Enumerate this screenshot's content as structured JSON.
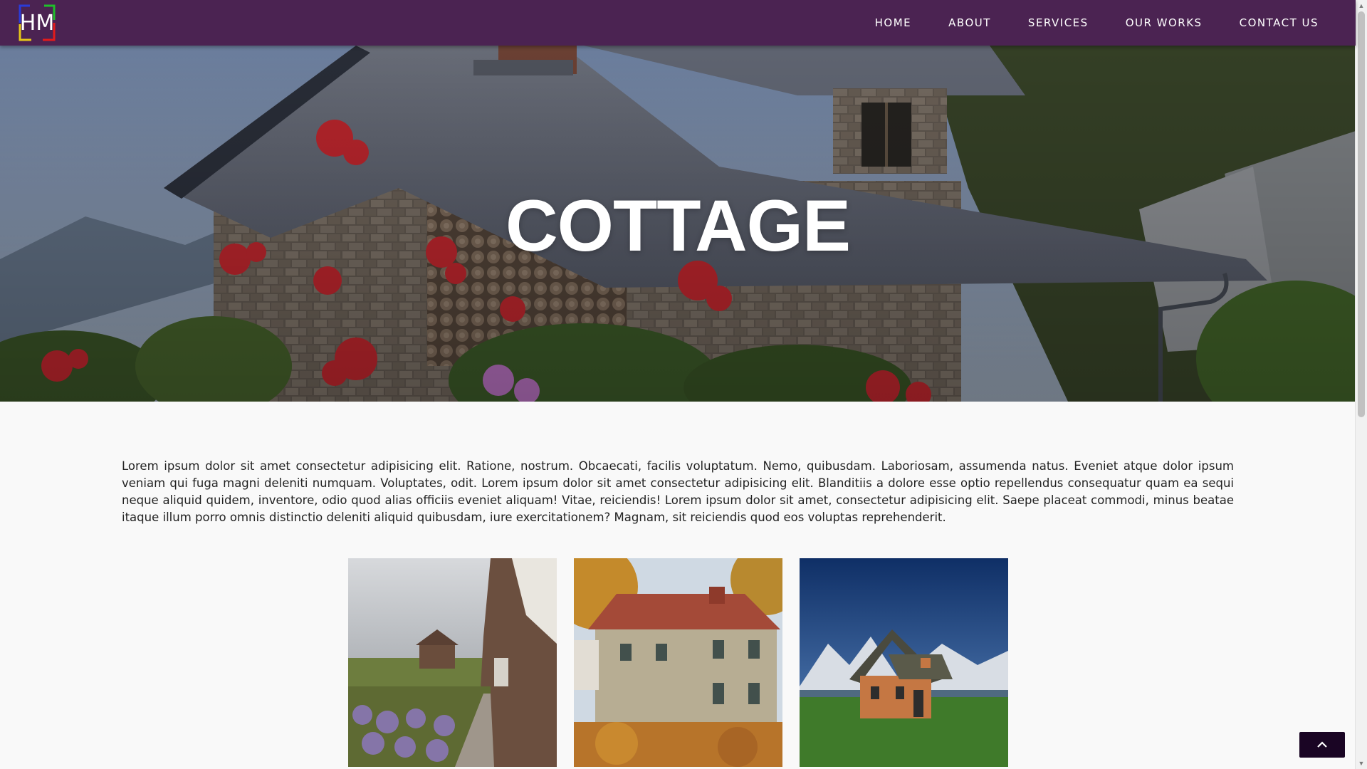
{
  "logo": {
    "text": "HM"
  },
  "nav": {
    "items": [
      "HOME",
      "ABOUT",
      "SERVICES",
      "OUR WORKS",
      "CONTACT US"
    ]
  },
  "hero": {
    "title": "COTTAGE"
  },
  "intro": {
    "text": "Lorem ipsum dolor sit amet consectetur adipisicing elit. Ratione, nostrum. Obcaecati, facilis voluptatum. Nemo, quibusdam. Laboriosam, assumenda natus. Eveniet atque dolor ipsum veniam qui fuga magni deleniti numquam. Voluptates, odit. Lorem ipsum dolor sit amet consectetur adipisicing elit. Blanditiis a dolore esse optio repellendus consequatur quam ea sequi neque aliquid quidem, inventore, odio quod alias officiis eveniet aliquam! Vitae, reiciendis! Lorem ipsum dolor sit amet, consectetur adipisicing elit. Saepe placeat commodi, minus beatae itaque illum porro omnis distinctio deleniti aliquid quibusdam, iure exercitationem? Magnam, sit reiciendis quod eos voluptas reprehenderit."
  },
  "colors": {
    "navbar": "#4b2352",
    "back_to_top": "#1a0524",
    "logo_bracket_left": "#2a3bd9",
    "logo_bracket_right_top": "#1fbf2a",
    "logo_bracket_bottom_left": "#e6c619",
    "logo_bracket_bottom_right": "#e31b1b"
  },
  "icons": {
    "back_to_top": "chevron-up-icon",
    "scroll_up": "scroll-up-arrow-icon",
    "scroll_down": "scroll-down-arrow-icon"
  }
}
